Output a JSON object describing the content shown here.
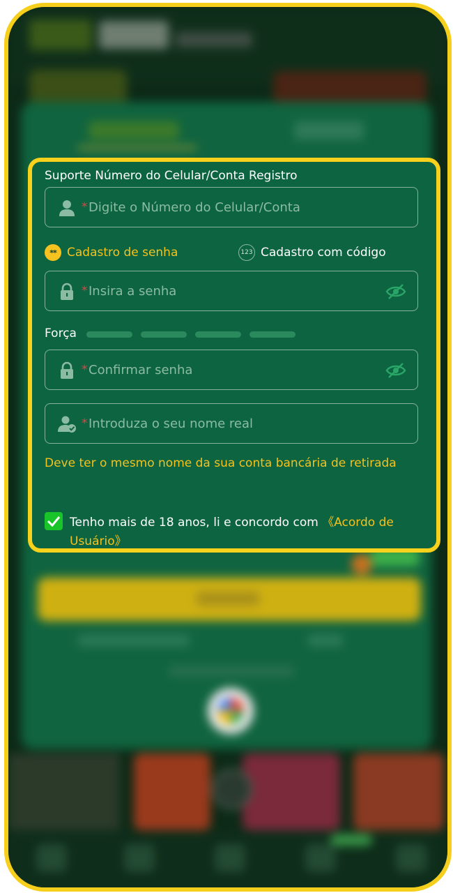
{
  "form": {
    "account_label": "Suporte Número do Celular/Conta Registro",
    "required_mark": "*",
    "account_placeholder": "Digite o Número do Celular/Conta",
    "option_password": "Cadastro de senha",
    "option_password_icon_text": "**",
    "option_code": "Cadastro com código",
    "option_code_icon_text": "123",
    "password_placeholder": "Insira a senha",
    "strength_label": "Força",
    "confirm_placeholder": "Confirmar senha",
    "realname_placeholder": "Introduza o seu nome real",
    "realname_warning": "Deve ter o mesmo nome da sua conta bancária de retirada",
    "agree_text": "Tenho mais de 18 anos, li e concordo com ",
    "agree_link": "《Acordo de Usuário》",
    "agree_checked": true
  },
  "colors": {
    "card_border": "#f8d11d",
    "card_bg": "#0d6441",
    "accent": "#f4c21e",
    "checkbox": "#18c429"
  },
  "icons": [
    "user-icon",
    "lock-icon",
    "eye-slash-icon",
    "user-check-icon",
    "check-icon"
  ]
}
